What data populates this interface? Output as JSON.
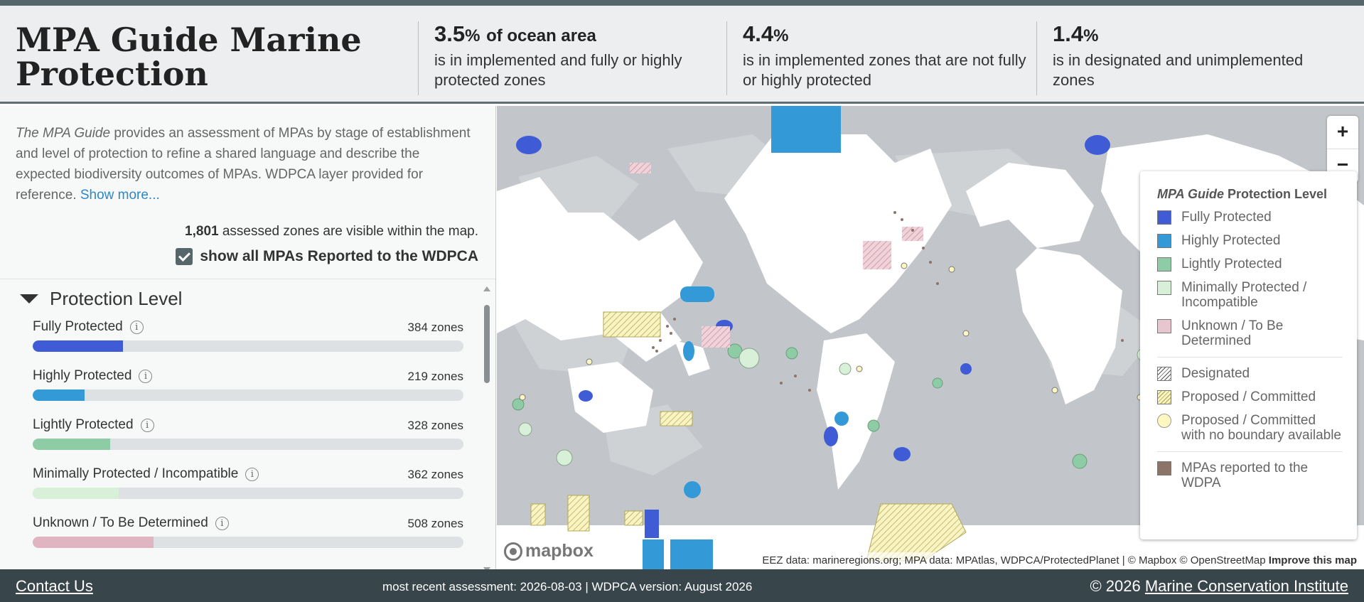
{
  "header": {
    "title": "MPA Guide Marine Protection",
    "stats": [
      {
        "value": "3.5",
        "unit": "%",
        "suffix": "of ocean area",
        "desc": "is in implemented and fully or highly protected zones"
      },
      {
        "value": "4.4",
        "unit": "%",
        "suffix": "",
        "desc": "is in implemented zones that are not fully or highly protected"
      },
      {
        "value": "1.4",
        "unit": "%",
        "suffix": "",
        "desc": "is in designated and unimplemented zones"
      }
    ]
  },
  "sidebar": {
    "intro_em": "The MPA Guide",
    "intro_text": " provides an assessment of MPAs by stage of establishment and level of protection to refine a shared language and describe the expected biodiversity outcomes of MPAs. WDPCA layer provided for reference. ",
    "show_more": "Show more...",
    "visible_count": "1,801",
    "visible_text": " assessed zones are visible within the map.",
    "wdpca_toggle_label": "show all MPAs Reported to the WDPCA",
    "section_title": "Protection Level",
    "levels": [
      {
        "label": "Fully Protected",
        "count": "384 zones",
        "fraction": 0.21,
        "color": "#3f5bd6"
      },
      {
        "label": "Highly Protected",
        "count": "219 zones",
        "fraction": 0.12,
        "color": "#3399d7"
      },
      {
        "label": "Lightly Protected",
        "count": "328 zones",
        "fraction": 0.18,
        "color": "#8dcca5"
      },
      {
        "label": "Minimally Protected / Incompatible",
        "count": "362 zones",
        "fraction": 0.2,
        "color": "#d8f0d8"
      },
      {
        "label": "Unknown / To Be Determined",
        "count": "508 zones",
        "fraction": 0.28,
        "color": "#e0b4c0"
      }
    ]
  },
  "map": {
    "zoom_in": "+",
    "zoom_out": "−",
    "legend": {
      "title_em": "MPA Guide",
      "title_rest": " Protection Level",
      "items": [
        {
          "label": "Fully Protected",
          "color": "#3f5bd6"
        },
        {
          "label": "Highly Protected",
          "color": "#3399d7"
        },
        {
          "label": "Lightly Protected",
          "color": "#8dcca5"
        },
        {
          "label": "Minimally Protected / Incompatible",
          "color": "#d8f0d8"
        },
        {
          "label": "Unknown / To Be Determined",
          "color": "#e8c6cf"
        }
      ],
      "designated": "Designated",
      "proposed": "Proposed / Committed",
      "proposed_no_boundary": "Proposed / Committed with no boundary available",
      "wdpa": "MPAs reported to the WDPA",
      "wdpa_color": "#8c7468"
    },
    "mapbox_logo": "mapbox",
    "attribution": "EEZ data: marineregions.org; MPA data: MPAtlas, WDPCA/ProtectedPlanet | © Mapbox © OpenStreetMap ",
    "improve": "Improve this map"
  },
  "footer": {
    "contact": "Contact Us",
    "meta": "most recent assessment: 2026-08-03  |  WDPCA version: August 2026",
    "copyright_prefix": "© 2026 ",
    "copyright_org": "Marine Conservation Institute"
  }
}
